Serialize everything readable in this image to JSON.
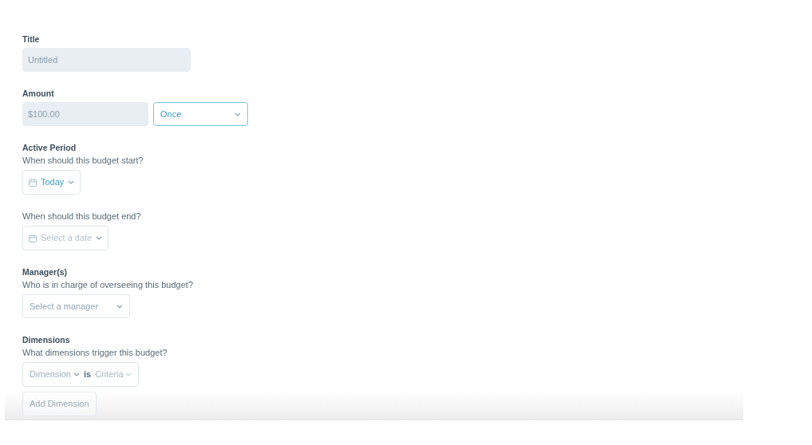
{
  "sections": [
    {
      "label": "Title",
      "controls": [
        {
          "kind": "text",
          "placeholder": "Untitled"
        }
      ]
    },
    {
      "label": "Amount",
      "controls": [
        {
          "kind": "money",
          "placeholder": "$100.00"
        },
        {
          "kind": "select",
          "value": "Once",
          "focused": true
        }
      ]
    },
    {
      "label": "Active Period",
      "question": "When should this budget start?",
      "controls": [
        {
          "kind": "date",
          "value": "Today",
          "filled": true
        }
      ]
    },
    {
      "question": "When should this budget end?",
      "controls": [
        {
          "kind": "date",
          "value": "Select a date",
          "filled": false
        }
      ]
    },
    {
      "label": "Manager(s)",
      "question": "Who is in charge of overseeing this budget?",
      "controls": [
        {
          "kind": "select",
          "value": "Select a manager",
          "focused": false,
          "placeholder": true
        }
      ]
    },
    {
      "label": "Dimensions",
      "question": "What dimensions trigger this budget?",
      "controls": [
        {
          "kind": "dimension",
          "dimension": "Dimension",
          "operator": "is",
          "criteria": "Criteria"
        }
      ]
    }
  ],
  "add_button": {
    "label": "Add Dimension",
    "disabled": true
  }
}
